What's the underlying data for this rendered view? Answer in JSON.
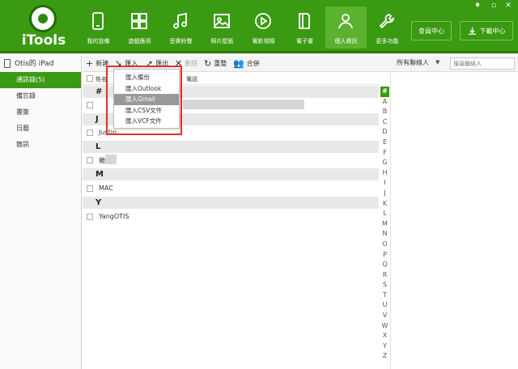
{
  "app": {
    "name": "iTools",
    "accent": "#3a9a12"
  },
  "window_controls": [
    "♦",
    "▫",
    "✕"
  ],
  "nav": [
    {
      "label": "我的設備",
      "icon": "phone-icon"
    },
    {
      "label": "遊戲應用",
      "icon": "apps-grid-icon"
    },
    {
      "label": "音樂鈴聲",
      "icon": "music-note-icon"
    },
    {
      "label": "照片壁紙",
      "icon": "photo-icon"
    },
    {
      "label": "電影視頻",
      "icon": "play-icon"
    },
    {
      "label": "電子書",
      "icon": "book-icon"
    },
    {
      "label": "個人資訊",
      "icon": "person-icon",
      "active": true
    },
    {
      "label": "更多功能",
      "icon": "wrench-icon"
    }
  ],
  "header_buttons": {
    "member": "會員中心",
    "download": "下載中心"
  },
  "sidebar": {
    "device": "Otis的 iPad",
    "items": [
      {
        "label": "通訊錄(5)",
        "active": true
      },
      {
        "label": "備忘錄"
      },
      {
        "label": "書簽"
      },
      {
        "label": "日曆"
      },
      {
        "label": "簡訊"
      }
    ]
  },
  "toolbar": {
    "new": "新建",
    "import": "匯入",
    "export": "匯出",
    "delete": "刪除",
    "refresh": "重整",
    "merge": "合併",
    "filter": "所有聯絡人",
    "search_placeholder": "搜尋聯絡人"
  },
  "list": {
    "col_name": "姓名",
    "col_phone": "電話",
    "groups": [
      {
        "letter": "#",
        "rows": [
          ""
        ]
      },
      {
        "letter": "J",
        "rows": [
          "Justin"
        ]
      },
      {
        "letter": "L",
        "rows": [
          "雜"
        ]
      },
      {
        "letter": "M",
        "rows": [
          "MAC"
        ]
      },
      {
        "letter": "Y",
        "rows": [
          "YangOTIS"
        ]
      }
    ]
  },
  "import_menu": [
    {
      "label": "匯入備份"
    },
    {
      "label": "匯入Outlook"
    },
    {
      "label": "匯入Gmail",
      "highlighted": true
    },
    {
      "label": "匯入CSV文件"
    },
    {
      "label": "匯入VCF文件"
    }
  ],
  "alpha_index": [
    "#",
    "A",
    "B",
    "C",
    "D",
    "E",
    "F",
    "G",
    "H",
    "I",
    "J",
    "K",
    "L",
    "M",
    "N",
    "O",
    "P",
    "Q",
    "R",
    "S",
    "T",
    "U",
    "V",
    "W",
    "X",
    "Y",
    "Z"
  ]
}
